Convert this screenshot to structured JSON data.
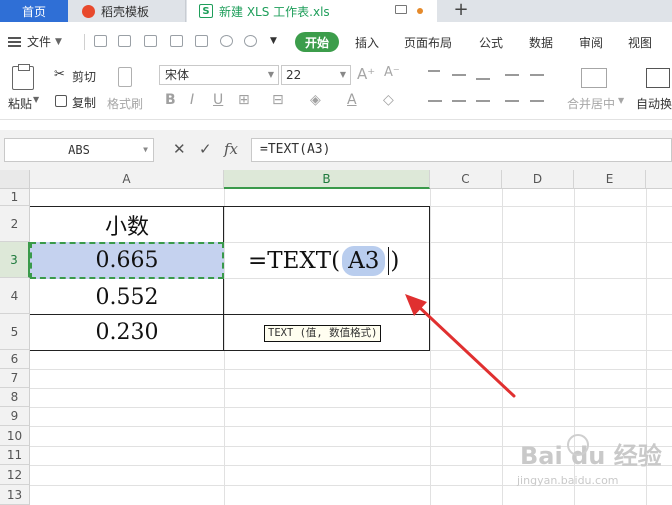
{
  "tabs": {
    "home": "首页",
    "template": "稻壳模板",
    "document": "新建 XLS 工作表.xls",
    "add": "+"
  },
  "menu": {
    "file": "文件",
    "start": "开始",
    "items": [
      "插入",
      "页面布局",
      "公式",
      "数据",
      "审阅",
      "视图"
    ]
  },
  "ribbon": {
    "paste": "粘贴",
    "cut": "剪切",
    "copy": "复制",
    "format_painter": "格式刷",
    "font_name": "宋体",
    "font_size": "22",
    "merge_center": "合并居中",
    "auto_wrap": "自动换"
  },
  "formula_bar": {
    "name_box": "ABS",
    "cancel_symbol": "✕",
    "confirm_symbol": "✓",
    "fx_label": "fx",
    "formula": "=TEXT(A3)"
  },
  "grid": {
    "columns": [
      "A",
      "B",
      "C",
      "D",
      "E"
    ],
    "rows": [
      "1",
      "2",
      "3",
      "4",
      "5",
      "6",
      "7",
      "8",
      "9",
      "10",
      "11",
      "12",
      "13"
    ],
    "cells": {
      "A2": "小数",
      "A3": "0.665",
      "A4": "0.552",
      "A5": "0.230"
    },
    "editing": {
      "prefix": "=TEXT(",
      "ref": "A3",
      "suffix": ")"
    },
    "tooltip": "TEXT (值, 数值格式)"
  },
  "watermark": {
    "brand": "Bai du 经验",
    "url": "jingyan.baidu.com"
  },
  "colors": {
    "accent_green": "#3c9d4b",
    "home_tab_blue": "#2f6fd6",
    "selection_fill": "#c5d2ef",
    "arrow_red": "#e03030"
  }
}
